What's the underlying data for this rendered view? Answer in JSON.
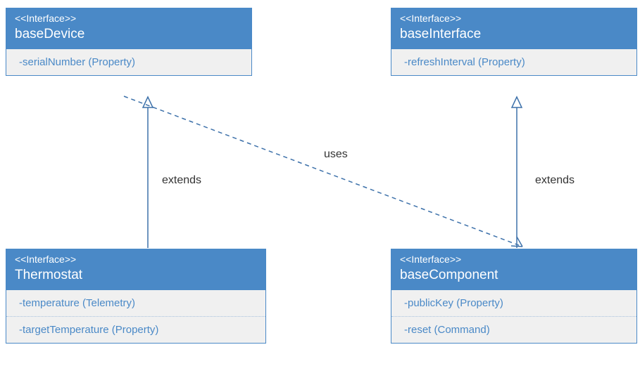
{
  "boxes": {
    "baseDevice": {
      "stereotype": "<<Interface>>",
      "title": "baseDevice",
      "attrs": [
        "-serialNumber (Property)"
      ]
    },
    "baseInterface": {
      "stereotype": "<<Interface>>",
      "title": "baseInterface",
      "attrs": [
        "-refreshInterval (Property)"
      ]
    },
    "thermostat": {
      "stereotype": "<<Interface>>",
      "title": "Thermostat",
      "attrs": [
        "-temperature (Telemetry)",
        "-targetTemperature (Property)"
      ]
    },
    "baseComponent": {
      "stereotype": "<<Interface>>",
      "title": "baseComponent",
      "attrs": [
        "-publicKey (Property)",
        "-reset (Command)"
      ]
    }
  },
  "labels": {
    "extendsLeft": "extends",
    "uses": "uses",
    "extendsRight": "extends"
  }
}
